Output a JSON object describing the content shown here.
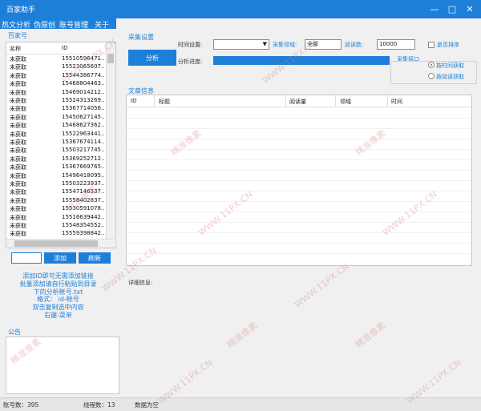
{
  "window": {
    "title": "百家助手"
  },
  "menu": {
    "items": [
      "热文分析",
      "伪原创",
      "账号管理",
      "关于"
    ]
  },
  "accounts": {
    "group_label": "百家号",
    "col_name": "名称",
    "col_id": "ID",
    "rows": [
      {
        "name": "未获取",
        "id": "15510596471..."
      },
      {
        "name": "未获取",
        "id": "15523065607..."
      },
      {
        "name": "未获取",
        "id": "15544386774..."
      },
      {
        "name": "未获取",
        "id": "15468804463..."
      },
      {
        "name": "未获取",
        "id": "15469014212..."
      },
      {
        "name": "未获取",
        "id": "15524313269..."
      },
      {
        "name": "未获取",
        "id": "15367714056..."
      },
      {
        "name": "未获取",
        "id": "15450627145..."
      },
      {
        "name": "未获取",
        "id": "15468627362..."
      },
      {
        "name": "未获取",
        "id": "15522963441..."
      },
      {
        "name": "未获取",
        "id": "15367674114..."
      },
      {
        "name": "未获取",
        "id": "15503217745..."
      },
      {
        "name": "未获取",
        "id": "15369252712..."
      },
      {
        "name": "未获取",
        "id": "15367669765..."
      },
      {
        "name": "未获取",
        "id": "15496418095..."
      },
      {
        "name": "未获取",
        "id": "15503223937..."
      },
      {
        "name": "未获取",
        "id": "15547146537..."
      },
      {
        "name": "未获取",
        "id": "15558402837..."
      },
      {
        "name": "未获取",
        "id": "15530591078..."
      },
      {
        "name": "未获取",
        "id": "15516639442..."
      },
      {
        "name": "未获取",
        "id": "15548354552..."
      },
      {
        "name": "未获取",
        "id": "15559398842..."
      }
    ],
    "add_input_value": "",
    "add_button": "添加",
    "refresh_button": "刷新"
  },
  "help_lines": [
    "添加ID即可无需添加链接",
    "批量添加请自行粘贴到目录",
    "下的分析帐号.txt",
    "格式： id-帐号",
    "双击复制选中内容",
    "右键-菜单"
  ],
  "notice": {
    "label": "公告",
    "text": ""
  },
  "collect": {
    "group_label": "采集设置",
    "analyze_button": "分析",
    "time_label": "时间设置:",
    "time_value": "",
    "domain_label": "采集领域:",
    "domain_value": "全部",
    "reads_label": "阅读数:",
    "reads_value": "10000",
    "dedupe_label": "是否排序",
    "progress_label": "分析进度:",
    "progress": 1.0,
    "interface_label": "采集接口",
    "radio_time": "按时间获取",
    "radio_reads": "按阅读获取"
  },
  "articles": {
    "group_label": "文章信息",
    "columns": [
      "ID",
      "标题",
      "阅读量",
      "领域",
      "时间"
    ]
  },
  "detail": {
    "label": "详细信息:",
    "text": ""
  },
  "status": {
    "accounts": "账号数：395",
    "threads": "线程数：13",
    "data": "数据为空"
  },
  "watermark": {
    "text1": "精准像素",
    "text2": "WWW.11PX.CN"
  },
  "colors": {
    "accent": "#1e7fd9"
  }
}
